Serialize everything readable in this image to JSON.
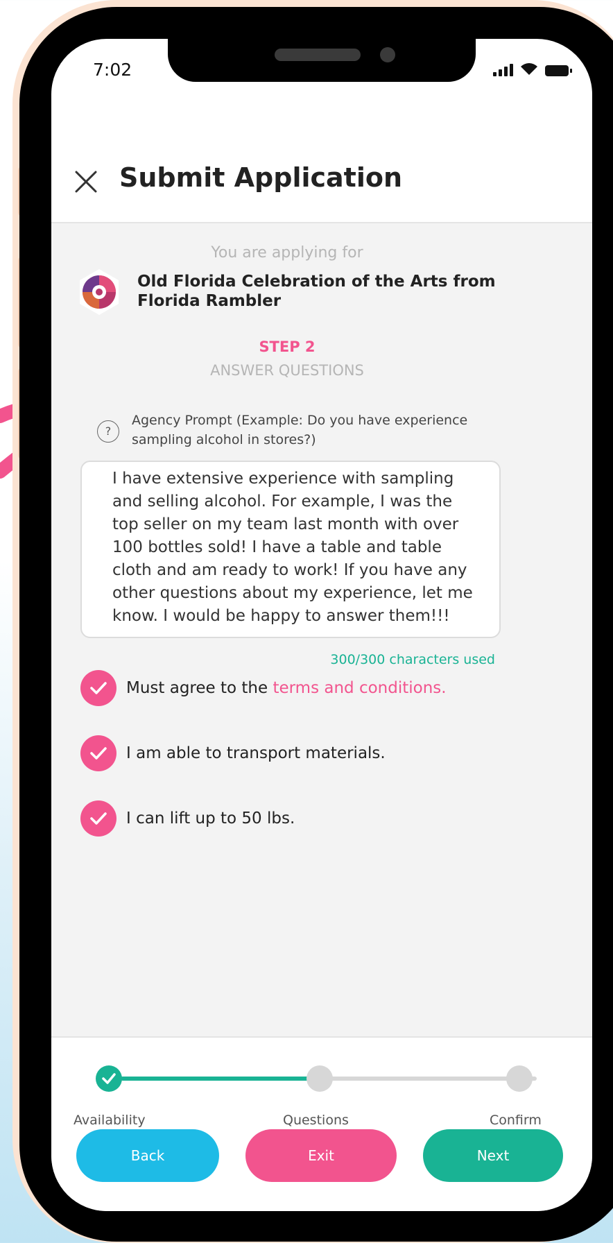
{
  "status_bar": {
    "time": "7:02"
  },
  "header": {
    "title": "Submit Application"
  },
  "application": {
    "applying_label": "You are applying for",
    "event_name": "Old Florida Celebration of the Arts from Florida Rambler",
    "step_number": "STEP 2",
    "step_name": "ANSWER QUESTIONS",
    "prompt": "Agency Prompt (Example: Do you have experience sampling alcohol in stores?)",
    "answer": "I have extensive experience with sampling and selling alcohol. For example, I was the top seller on my team last month with over 100 bottles sold! I have a table and table cloth and am ready to work! If you have any other questions about my experience, let me know. I would be happy to answer them!!!",
    "char_count": "300/300 characters used"
  },
  "checkboxes": {
    "terms_prefix": "Must agree to the ",
    "terms_link": "terms and conditions.",
    "transport": "I am able to transport materials.",
    "lift": "I can lift up to 50 lbs."
  },
  "progress": {
    "steps": [
      "Availability",
      "Questions",
      "Confirm"
    ],
    "completed_steps": 1
  },
  "buttons": {
    "back": "Back",
    "exit": "Exit",
    "next": "Next"
  },
  "colors": {
    "accent_pink": "#f2548e",
    "accent_teal": "#19b394",
    "back_blue": "#1ebbe6",
    "step_gray": "#d7d7d7"
  },
  "icons": [
    "close-icon",
    "signal-icon",
    "wifi-icon",
    "battery-icon",
    "event-logo",
    "help-icon",
    "check-icon",
    "arrow-annotation"
  ]
}
